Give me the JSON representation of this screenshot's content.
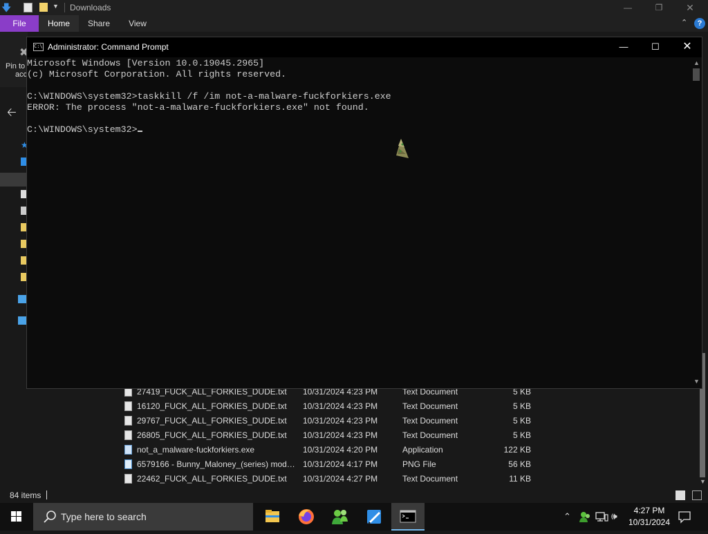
{
  "explorer": {
    "title": "Downloads",
    "tabs": [
      "File",
      "Home",
      "Share",
      "View"
    ],
    "help": "?",
    "pin_label_line1": "Pin to",
    "pin_label_line2": "acc",
    "files": [
      {
        "name": "27419_FUCK_ALL_FORKIES_DUDE.txt",
        "date": "10/31/2024 4:23 PM",
        "type": "Text Document",
        "size": "5 KB"
      },
      {
        "name": "16120_FUCK_ALL_FORKIES_DUDE.txt",
        "date": "10/31/2024 4:23 PM",
        "type": "Text Document",
        "size": "5 KB"
      },
      {
        "name": "29767_FUCK_ALL_FORKIES_DUDE.txt",
        "date": "10/31/2024 4:23 PM",
        "type": "Text Document",
        "size": "5 KB"
      },
      {
        "name": "26805_FUCK_ALL_FORKIES_DUDE.txt",
        "date": "10/31/2024 4:23 PM",
        "type": "Text Document",
        "size": "5 KB"
      },
      {
        "name": "not_a_malware-fuckforkiers.exe",
        "date": "10/31/2024 4:20 PM",
        "type": "Application",
        "size": "122 KB"
      },
      {
        "name": "6579166 - Bunny_Maloney_(series) modc...",
        "date": "10/31/2024 4:17 PM",
        "type": "PNG File",
        "size": "56 KB"
      },
      {
        "name": "22462_FUCK_ALL_FORKIES_DUDE.txt",
        "date": "10/31/2024 4:27 PM",
        "type": "Text Document",
        "size": "11 KB"
      }
    ],
    "status_count": "84 items"
  },
  "cmd": {
    "title": "Administrator: Command Prompt",
    "icon_text": "C:\\",
    "lines": [
      "Microsoft Windows [Version 10.0.19045.2965]",
      "(c) Microsoft Corporation. All rights reserved.",
      "",
      "C:\\WINDOWS\\system32>taskkill /f /im not-a-malware-fuckforkiers.exe",
      "ERROR: The process \"not-a-malware-fuckforkiers.exe\" not found.",
      "",
      "C:\\WINDOWS\\system32>"
    ]
  },
  "taskbar": {
    "search_placeholder": "Type here to search",
    "time": "4:27 PM",
    "date": "10/31/2024",
    "pinned_apps": [
      "file-explorer",
      "firefox",
      "people-app",
      "paint-app",
      "command-prompt"
    ]
  },
  "colors": {
    "file_tab": "#8a3dc8",
    "cmd_text": "#cccccc",
    "accent": "#76b9ed"
  }
}
